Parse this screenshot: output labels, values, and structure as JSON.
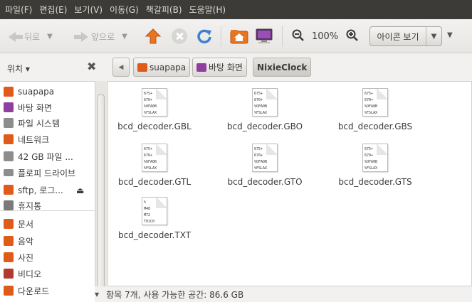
{
  "menu": [
    "파일(F)",
    "편집(E)",
    "보기(V)",
    "이동(G)",
    "책갈피(B)",
    "도움말(H)"
  ],
  "toolbar": {
    "back_label": "뒤로",
    "forward_label": "앞으로",
    "zoom_level": "100%",
    "view_mode": "아이콘 보기"
  },
  "sidebar": {
    "title": "위치",
    "items": [
      {
        "label": "suapapa",
        "icon": "home-folder-icon",
        "color": "#e05a1a"
      },
      {
        "label": "바탕 화면",
        "icon": "desktop-icon",
        "color": "#8e3fa0"
      },
      {
        "label": "파일 시스템",
        "icon": "drive-icon",
        "color": "#8d8d8d"
      },
      {
        "label": "네트워크",
        "icon": "network-folder-icon",
        "color": "#e05a1a"
      },
      {
        "label": "42 GB 파일 ...",
        "icon": "drive-icon",
        "color": "#8d8d8d"
      },
      {
        "label": "플로피 드라이브",
        "icon": "floppy-icon",
        "color": "#8d8d8d"
      },
      {
        "label": "sftp, 로그...",
        "icon": "remote-folder-icon",
        "color": "#e05a1a"
      },
      {
        "label": "휴지통",
        "icon": "trash-icon",
        "color": "#7a7a7a"
      },
      {
        "label": "문서",
        "icon": "documents-folder-icon",
        "color": "#e05a1a"
      },
      {
        "label": "음악",
        "icon": "music-folder-icon",
        "color": "#e05a1a"
      },
      {
        "label": "사진",
        "icon": "pictures-folder-icon",
        "color": "#e05a1a"
      },
      {
        "label": "비디오",
        "icon": "videos-folder-icon",
        "color": "#b03a2e"
      },
      {
        "label": "다운로드",
        "icon": "downloads-folder-icon",
        "color": "#e05a1a"
      }
    ]
  },
  "breadcrumbs": [
    {
      "label": "suapapa",
      "icon": "home-folder-icon",
      "color": "#e05a1a"
    },
    {
      "label": "바탕 화면",
      "icon": "desktop-icon",
      "color": "#8e3fa0"
    },
    {
      "label": "NixieClock",
      "active": true
    }
  ],
  "files": [
    {
      "name": "bcd_decoder.GBL",
      "preview": [
        "675+",
        "670+",
        "%OFA0B",
        "%FSLAX"
      ]
    },
    {
      "name": "bcd_decoder.GBO",
      "preview": [
        "675+",
        "670+",
        "%OFA0B",
        "%FSLAX"
      ]
    },
    {
      "name": "bcd_decoder.GBS",
      "preview": [
        "675+",
        "670+",
        "%OFA0B",
        "%FSLAX"
      ]
    },
    {
      "name": "bcd_decoder.GTL",
      "preview": [
        "675+",
        "670+",
        "%OFA0B",
        "%FSLAX"
      ]
    },
    {
      "name": "bcd_decoder.GTO",
      "preview": [
        "675+",
        "670+",
        "%OFA0B",
        "%FSLAX"
      ]
    },
    {
      "name": "bcd_decoder.GTS",
      "preview": [
        "675+",
        "670+",
        "%OFA0B",
        "%FSLAX"
      ]
    },
    {
      "name": "bcd_decoder.TXT",
      "preview": [
        "%",
        "M48",
        "M72",
        "T01C0"
      ]
    }
  ],
  "status": "항목 7개, 사용 가능한 공간: 86.6 GB"
}
